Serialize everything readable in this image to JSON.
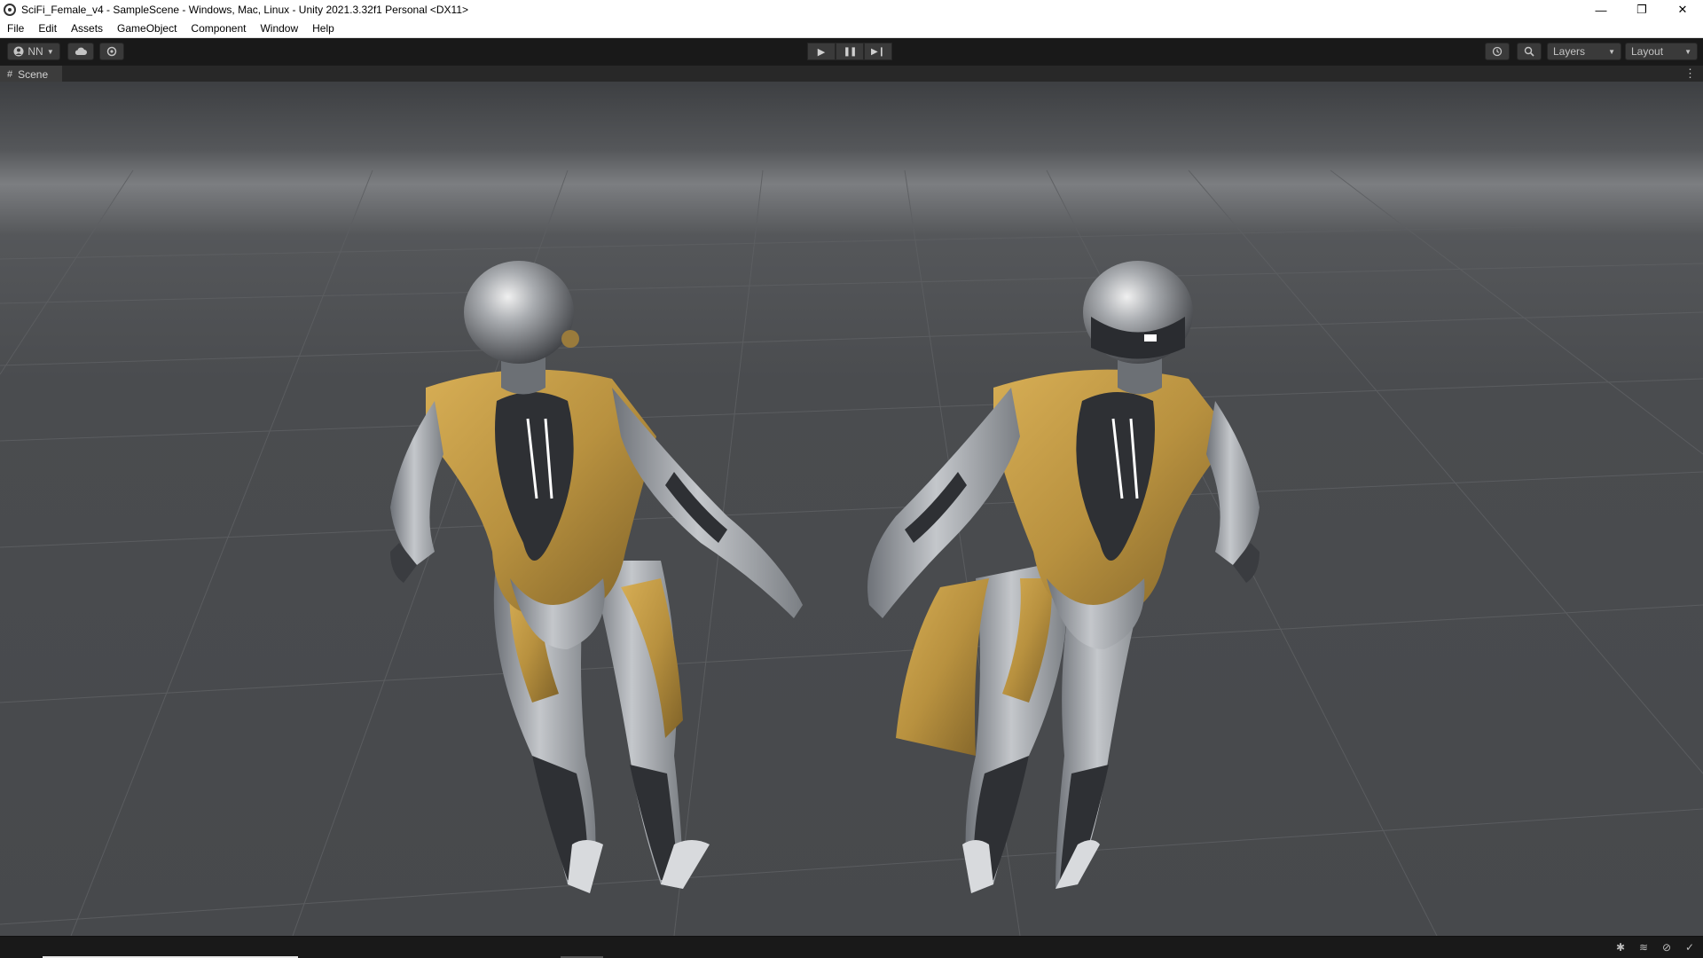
{
  "window": {
    "title": "SciFi_Female_v4 - SampleScene - Windows, Mac, Linux - Unity 2021.3.32f1 Personal <DX11>",
    "controls": {
      "minimize": "—",
      "restore": "❐",
      "close": "✕"
    }
  },
  "menu": [
    "File",
    "Edit",
    "Assets",
    "GameObject",
    "Component",
    "Window",
    "Help"
  ],
  "toolbar": {
    "account_label": "NN",
    "layers_label": "Layers",
    "layout_label": "Layout",
    "icons": [
      "account-icon",
      "cloud-icon",
      "collab-icon",
      "play-icon",
      "pause-icon",
      "step-icon",
      "history-icon",
      "search-icon"
    ]
  },
  "scene": {
    "tab_label": "Scene",
    "tab_icon": "grid-icon"
  },
  "statusbar": {
    "icons": [
      "bug-icon",
      "layers-stack-icon",
      "visibility-icon",
      "check-circle-icon"
    ]
  },
  "colors": {
    "suit_gold": "#b8913f",
    "suit_silver": "#a6aaae",
    "suit_dark": "#2e3034",
    "glow": "#ffffff"
  }
}
